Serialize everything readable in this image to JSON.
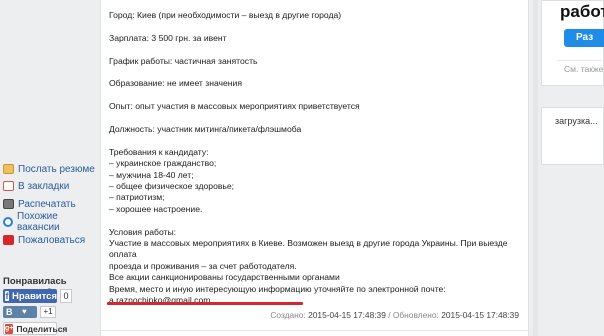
{
  "sidebar": {
    "actions": [
      {
        "label": "Послать резюме",
        "icon": "mail-icon",
        "color": "#f0c060"
      },
      {
        "label": "В закладки",
        "icon": "bookmark-icon",
        "color": "#d9534f"
      },
      {
        "label": "Распечатать",
        "icon": "printer-icon",
        "color": "#555555"
      },
      {
        "label": "Похожие вакансии",
        "icon": "search-icon",
        "color": "#2a7fd4"
      },
      {
        "label": "Пожаловаться",
        "icon": "warning-icon",
        "color": "#d9262b"
      }
    ],
    "likes_title": "Понравилась вакансия?",
    "facebook": {
      "label": "Нравится",
      "count": "0"
    },
    "vk": {
      "label": "В",
      "count": "+1"
    },
    "google": {
      "label": "Поделиться"
    }
  },
  "vacancy": {
    "city": "Город: Киев (при необходимости – выезд в другие города)",
    "salary": "Зарплата: 3 500 грн. за ивент",
    "schedule": "График работы: частичная занятость",
    "education": "Образование: не имеет значения",
    "experience": "Опыт: опыт участия в массовых мероприятиях приветствуется",
    "position": "Должность: участник митинга/пикета/флэшмоба",
    "requirements_title": "Требования к кандидату:",
    "requirements": [
      "– украинское гражданство;",
      "– мужчина 18-40 лет;",
      "– общее физическое здоровье;",
      "– патриотизм;",
      "– хорошее настроение."
    ],
    "conditions_title": "Условия работы:",
    "conditions": [
      "Участие в массовых мероприятиях в Киеве. Возможен выезд в другие города Украины. При выезде оплата",
      "проезда и проживания – за счет работодателя.",
      "Все акции санкционированы государственными органами",
      "Время, место и иную интересующую информацию уточняйте по электронной почте:"
    ],
    "email": "a.raznochinko@gmail.com",
    "created_label": "Создано:",
    "created_date": "2015-04-15 17:48:39",
    "updated_label": "/ Обновлено:",
    "updated_date": "2015-04-15 17:48:39"
  },
  "right": {
    "promo_title": "работ",
    "promo_button": "Раз",
    "promo_more": "См. также",
    "loading": "загрузка..."
  }
}
